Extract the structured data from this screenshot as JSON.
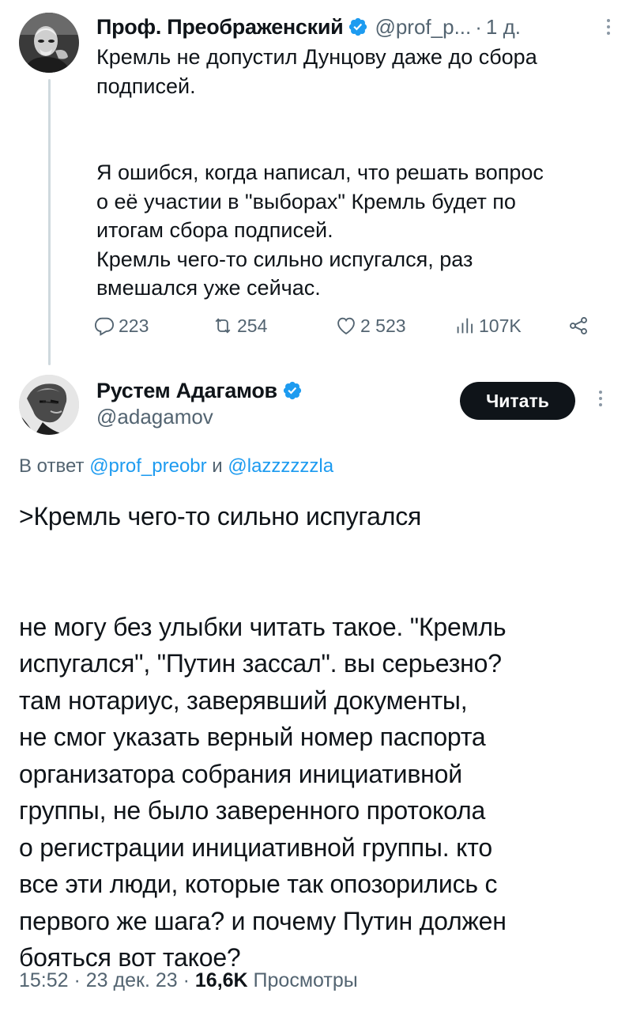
{
  "parent_tweet": {
    "author_name": "Проф. Преображенский",
    "handle": "@prof_p...",
    "separator": "·",
    "time": "1 д.",
    "text": "Кремль не допустил Дунцову даже до сбора\nподписей.\n\n\nЯ ошибся, когда написал, что решать вопрос\nо её участии в \"выборах\" Кремль будет по\nитогам сбора подписей.\nКремль чего-то сильно испугался, раз\nвмешался уже сейчас.",
    "replies": "223",
    "retweets": "254",
    "likes": "2 523",
    "views": "107K",
    "icons": [
      "reply-icon",
      "retweet-icon",
      "like-icon",
      "views-icon",
      "share-icon",
      "more-icon",
      "verified-badge-icon"
    ]
  },
  "main_tweet": {
    "author_name": "Рустем Адагамов",
    "handle": "@adagamov",
    "follow_label": "Читать",
    "reply_prefix": "В ответ ",
    "reply_user1": "@prof_preobr",
    "reply_conj": " и ",
    "reply_user2": "@lazzzzzzla",
    "text": ">Кремль чего-то сильно испугался\n\n\nне могу без улыбки читать такое. \"Кремль\nиспугался\", \"Путин зассал\". вы серьезно?\nтам нотариус, заверявший документы,\nне смог указать верный номер паспорта\nорганизатора собрания инициативной\nгруппы, не было заверенного протокола\nо регистрации инициативной группы. кто\nвсе эти люди, которые так опозорились с\nпервого же шага? и почему Путин должен\nбояться вот такое?",
    "time": "15:52",
    "sep1": " · ",
    "date": "23 дек. 23",
    "sep2": " · ",
    "views_count": "16,6K",
    "views_label": " Просмотры"
  },
  "colors": {
    "text": "#0f1419",
    "secondary": "#536471",
    "link": "#1d9bf0",
    "verified": "#1d9bf0",
    "button_bg": "#0f1419",
    "thread_line": "#cfd9de"
  }
}
